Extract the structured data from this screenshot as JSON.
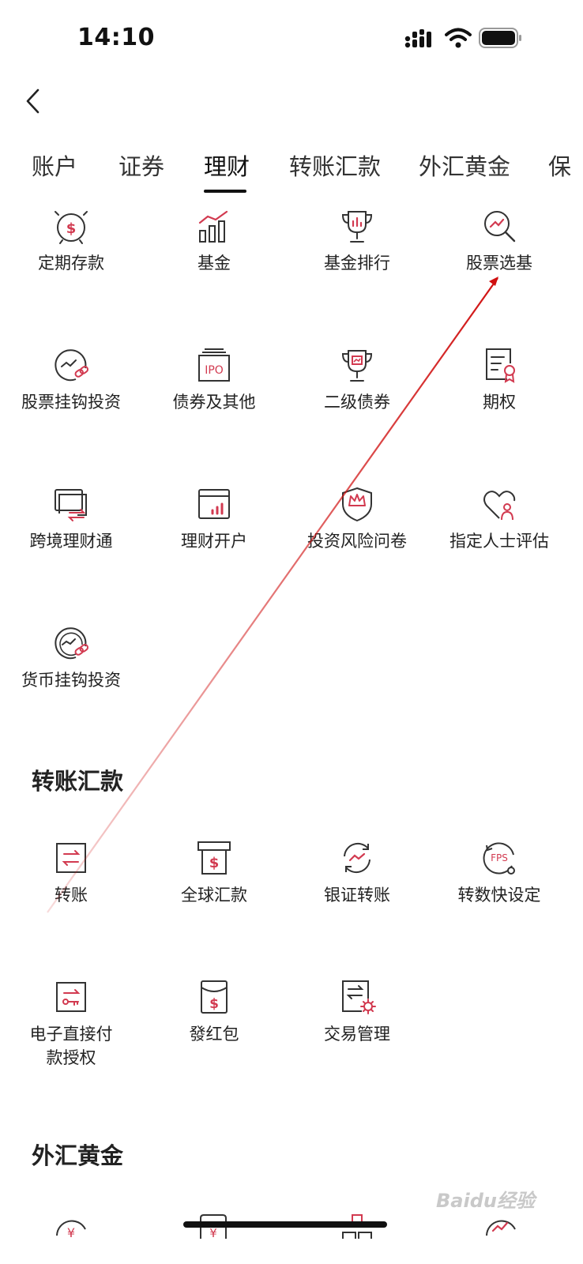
{
  "status_bar": {
    "time": "14:10"
  },
  "tabs": [
    {
      "label": "账户"
    },
    {
      "label": "证券"
    },
    {
      "label": "理财",
      "active": true
    },
    {
      "label": "转账汇款"
    },
    {
      "label": "外汇黄金"
    },
    {
      "label": "保"
    }
  ],
  "wealth": {
    "items": [
      {
        "label": "定期存款",
        "icon": "clock-dollar-icon"
      },
      {
        "label": "基金",
        "icon": "bar-chart-icon"
      },
      {
        "label": "基金排行",
        "icon": "trophy-chart-icon"
      },
      {
        "label": "股票选基",
        "icon": "magnifier-chart-icon"
      },
      {
        "label": "股票挂钩投资",
        "icon": "gauge-link-icon"
      },
      {
        "label": "债券及其他",
        "icon": "ipo-icon"
      },
      {
        "label": "二级债券",
        "icon": "trophy-doc-icon"
      },
      {
        "label": "期权",
        "icon": "document-badge-icon"
      },
      {
        "label": "跨境理财通",
        "icon": "cards-exchange-icon"
      },
      {
        "label": "理财开户",
        "icon": "window-chart-icon"
      },
      {
        "label": "投资风险问卷",
        "icon": "shield-crown-icon"
      },
      {
        "label": "指定人士评估",
        "icon": "heart-person-icon"
      },
      {
        "label": "货币挂钩投资",
        "icon": "gauge-link-icon"
      }
    ]
  },
  "transfer": {
    "title": "转账汇款",
    "items": [
      {
        "label": "转账",
        "icon": "transfer-arrows-icon"
      },
      {
        "label": "全球汇款",
        "icon": "dollar-card-icon"
      },
      {
        "label": "银证转账",
        "icon": "cycle-chart-icon"
      },
      {
        "label": "转数快设定",
        "icon": "fps-icon"
      },
      {
        "label": "电子直接付款授权",
        "label_line1": "电子直接付",
        "label_line2": "款授权",
        "icon": "key-transfer-icon"
      },
      {
        "label": "發红包",
        "icon": "red-packet-icon"
      },
      {
        "label": "交易管理",
        "icon": "document-gear-icon"
      }
    ]
  },
  "forex": {
    "title": "外汇黄金"
  },
  "watermark": "Baidu经验",
  "colors": {
    "accent": "#d23a50",
    "line": "#333333",
    "annotation": "#d01010"
  }
}
